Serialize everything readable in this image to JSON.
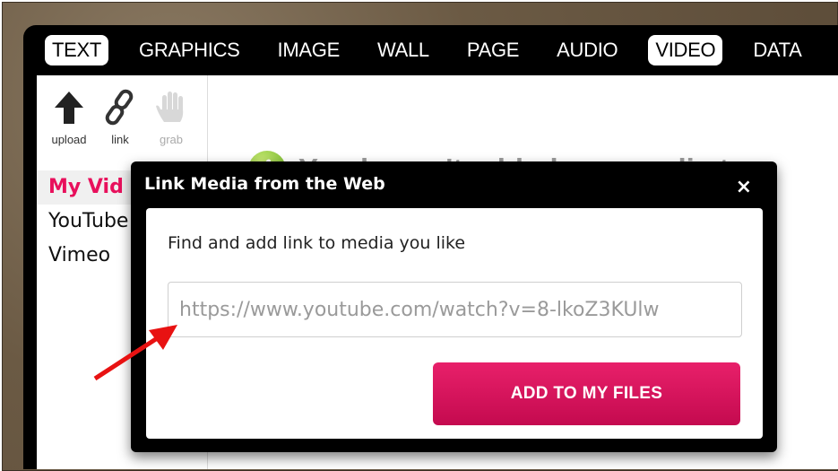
{
  "tabs": [
    {
      "label": "TEXT",
      "active": true
    },
    {
      "label": "GRAPHICS",
      "active": false
    },
    {
      "label": "IMAGE",
      "active": false
    },
    {
      "label": "WALL",
      "active": false
    },
    {
      "label": "PAGE",
      "active": false
    },
    {
      "label": "AUDIO",
      "active": false
    },
    {
      "label": "VIDEO",
      "active": true
    },
    {
      "label": "DATA",
      "active": false
    }
  ],
  "tools": [
    {
      "label": "upload",
      "icon": "upload-arrow-icon"
    },
    {
      "label": "link",
      "icon": "chain-link-icon"
    },
    {
      "label": "grab",
      "icon": "hand-grab-icon",
      "disabled": true
    }
  ],
  "sidebar": {
    "items": [
      {
        "label": "My Vid",
        "active": true
      },
      {
        "label": "YouTube",
        "active": false
      },
      {
        "label": "Vimeo",
        "active": false
      }
    ]
  },
  "main": {
    "empty_message": "You haven't added any media to",
    "info_icon": "info-icon",
    "info_glyph": "i"
  },
  "modal": {
    "title": "Link Media from the Web",
    "close_label": "×",
    "description": "Find and add link to media you like",
    "url_placeholder": "https://www.youtube.com/watch?v=8-lkoZ3KUlw",
    "add_button": "ADD TO MY FILES"
  },
  "colors": {
    "accent": "#e8105c",
    "button_top": "#e8206a",
    "button_bottom": "#c40a4f",
    "info_green": "#8cc63f",
    "arrow_red": "#e81212"
  }
}
